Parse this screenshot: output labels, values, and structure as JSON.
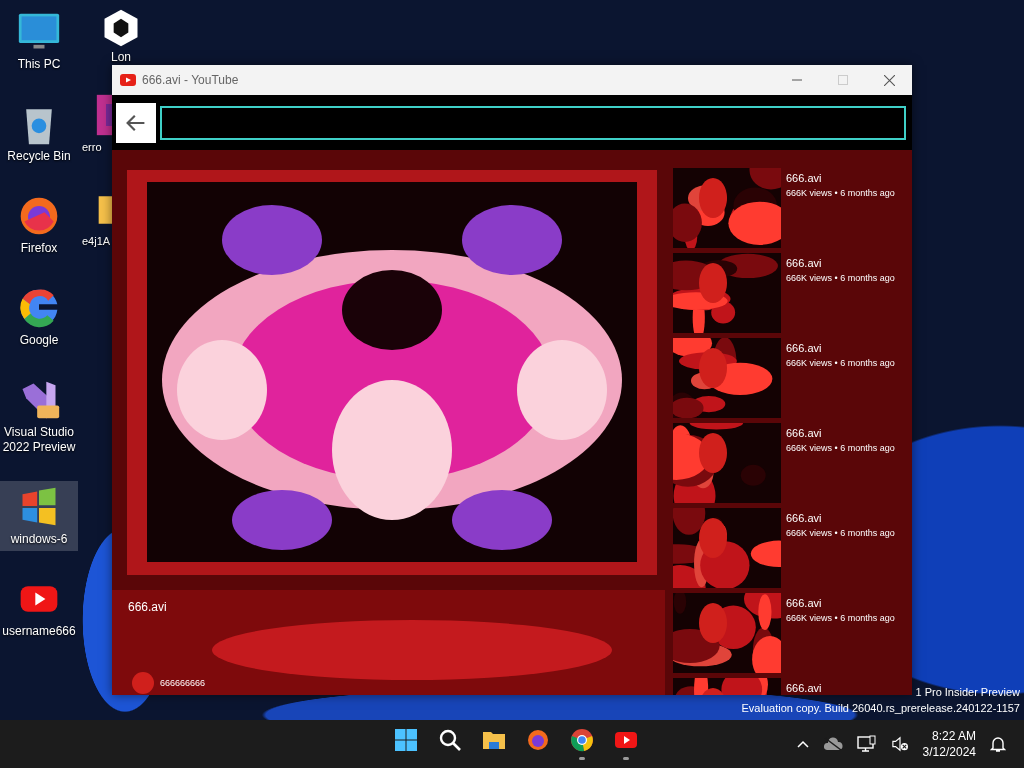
{
  "desktop_icons": [
    {
      "label": "This PC",
      "selected": false
    },
    {
      "label": "Recycle Bin",
      "selected": false
    },
    {
      "label": "Firefox",
      "selected": false
    },
    {
      "label": "Google",
      "selected": false
    },
    {
      "label": "Visual Studio 2022 Preview",
      "selected": false
    },
    {
      "label": "windows-6",
      "selected": true
    },
    {
      "label": "username666",
      "selected": false
    },
    {
      "label": "Lon",
      "selected": false
    },
    {
      "label": "erro",
      "selected": false
    },
    {
      "label": "e4j1A",
      "selected": false
    }
  ],
  "window": {
    "title": "666.avi - YouTube",
    "main_video": {
      "title": "666.avi",
      "channel": "666666666"
    },
    "related": [
      {
        "title": "666.avi",
        "meta": "666K views • 6 months ago"
      },
      {
        "title": "666.avi",
        "meta": "666K views • 6 months ago"
      },
      {
        "title": "666.avi",
        "meta": "666K views • 6 months ago"
      },
      {
        "title": "666.avi",
        "meta": "666K views • 6 months ago"
      },
      {
        "title": "666.avi",
        "meta": "666K views • 6 months ago"
      },
      {
        "title": "666.avi",
        "meta": "666K views • 6 months ago"
      },
      {
        "title": "666.avi"
      }
    ]
  },
  "watermark": [
    "1 Pro Insider Preview",
    "Evaluation copy. Build 26040.rs_prerelease.240122-1157"
  ],
  "taskbar": {
    "apps": [
      {
        "running": false
      },
      {
        "running": false
      },
      {
        "running": false
      },
      {
        "running": false
      },
      {
        "running": true
      },
      {
        "running": true
      }
    ],
    "time": "8:22 AM",
    "date": "3/12/2024"
  }
}
